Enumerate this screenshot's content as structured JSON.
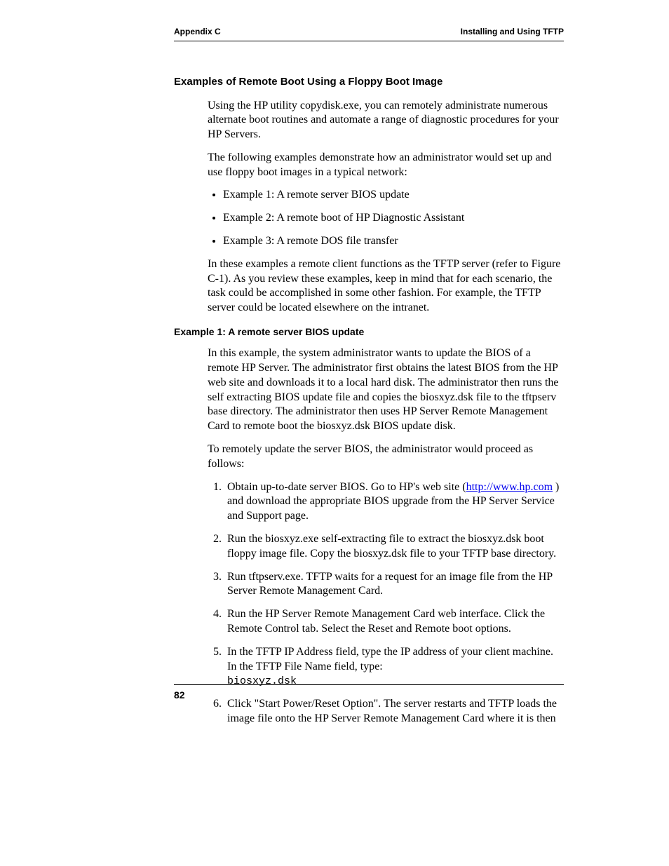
{
  "header": {
    "left": "Appendix C",
    "right": "Installing and Using TFTP"
  },
  "h1": "Examples of Remote Boot Using a Floppy Boot Image",
  "intro": {
    "p1": "Using the HP utility copydisk.exe, you can remotely administrate numerous alternate boot routines and automate a range of diagnostic procedures for your HP Servers.",
    "p2": "The following examples demonstrate how an administrator would set up and use floppy boot images in a typical network:"
  },
  "examples": [
    "Example 1: A remote server BIOS update",
    "Example 2: A remote boot of HP Diagnostic Assistant",
    "Example 3: A remote DOS file transfer"
  ],
  "note": "In these examples a remote client functions as the TFTP server (refer to Figure C-1). As you review these examples, keep in mind that for each scenario, the task could be accomplished in some other fashion. For example, the TFTP server could be located elsewhere on the intranet.",
  "h2": "Example 1: A remote server BIOS update",
  "ex1": {
    "p1": "In this example, the system administrator wants to update the BIOS of a remote HP Server. The administrator first obtains the latest BIOS from the HP web site and downloads it to a local hard disk. The administrator then runs the self extracting BIOS update file and copies the biosxyz.dsk file to the tftpserv base directory. The administrator then uses HP Server Remote Management Card to remote boot the biosxyz.dsk BIOS update disk.",
    "p2": "To remotely update the server BIOS, the administrator would proceed as follows:"
  },
  "steps": {
    "s1a": "Obtain up-to-date server BIOS. Go to HP's web site (",
    "s1link": "http://www.hp.com",
    "s1b": " ) and download the appropriate BIOS upgrade from the HP Server Service and Support page.",
    "s2": "Run the biosxyz.exe self-extracting file to extract the biosxyz.dsk boot floppy image file. Copy the biosxyz.dsk file to your TFTP base directory.",
    "s3": "Run tftpserv.exe. TFTP waits for a request for an image file from the HP Server Remote Management Card.",
    "s4": "Run the HP Server Remote Management Card web interface. Click the Remote Control tab. Select the Reset and Remote boot options.",
    "s5a": "In the TFTP IP Address field, type the IP address of your client machine. In the TFTP File Name field, type:",
    "s5mono": "biosxyz.dsk",
    "s6": "Click \"Start Power/Reset Option\". The server restarts and TFTP loads the image file onto the HP Server Remote Management Card where it is then"
  },
  "page_number": "82"
}
